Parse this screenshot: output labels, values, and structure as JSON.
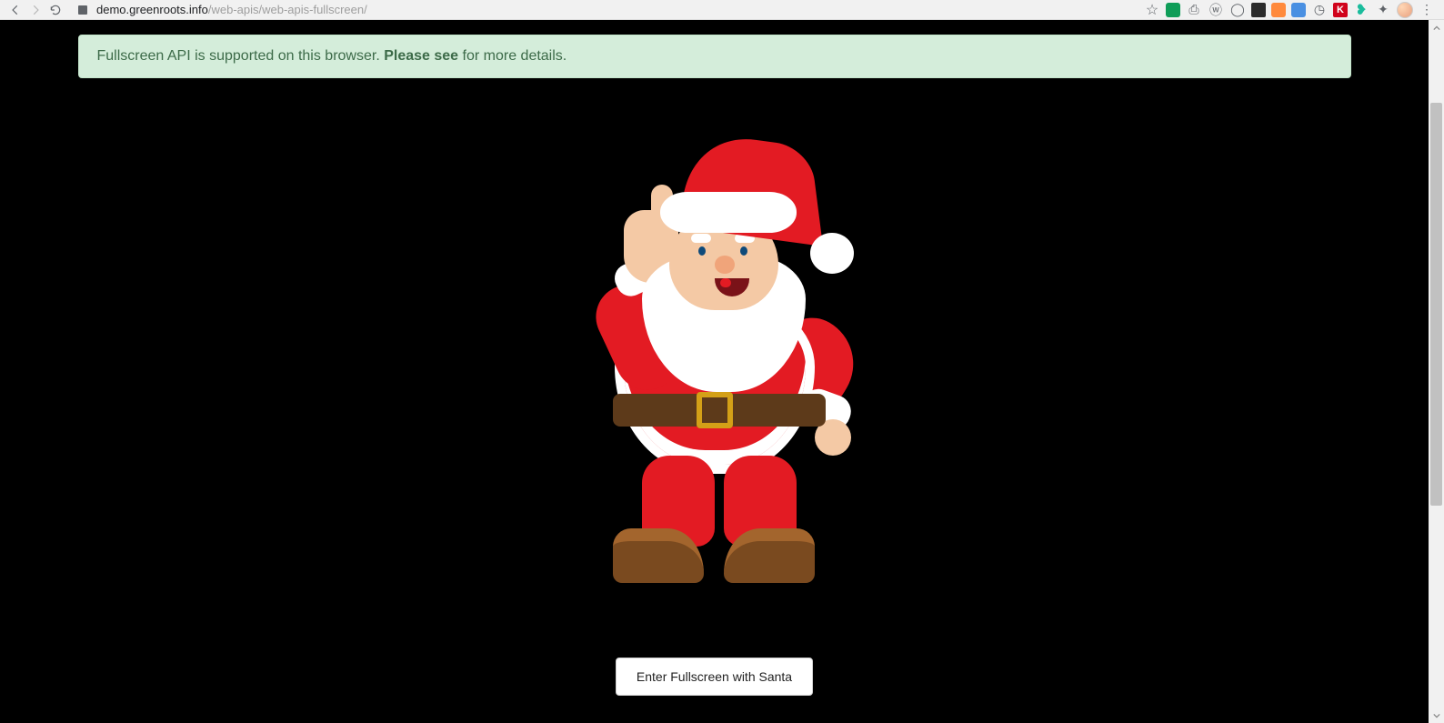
{
  "browser": {
    "url_domain": "demo.greenroots.info",
    "url_path": "/web-apis/web-apis-fullscreen/",
    "nav": {
      "back": "←",
      "forward": "→",
      "reload": "↻"
    },
    "star": "☆",
    "extensions": [
      {
        "name": "evernote-extension-icon",
        "glyph": "",
        "cls": "ext-green square"
      },
      {
        "name": "screenshot-extension-icon",
        "glyph": "⎙",
        "cls": "ext-plain"
      },
      {
        "name": "wordpress-extension-icon",
        "glyph": "ⓦ",
        "cls": "ext-plain"
      },
      {
        "name": "circle-extension-icon",
        "glyph": "◯",
        "cls": "ext-plain"
      },
      {
        "name": "grid-extension-icon",
        "glyph": "",
        "cls": "ext-dark square"
      },
      {
        "name": "swirl-extension-icon",
        "glyph": "",
        "cls": "ext-orange square"
      },
      {
        "name": "search-extension-icon",
        "glyph": "",
        "cls": "ext-blue square"
      },
      {
        "name": "clock-extension-icon",
        "glyph": "◷",
        "cls": "ext-plain"
      },
      {
        "name": "k-extension-icon",
        "glyph": "K",
        "cls": "ext-kred square"
      },
      {
        "name": "tag-extension-icon",
        "glyph": "❥",
        "cls": "ext-teal"
      },
      {
        "name": "puzzle-extension-icon",
        "glyph": "✦",
        "cls": "ext-plain"
      }
    ],
    "menu_glyph": "⋮"
  },
  "banner": {
    "text_before": "Fullscreen API is supported on this browser. ",
    "link_text": "Please see",
    "text_after": " for more details."
  },
  "main": {
    "image_alt": "santa-claus-image",
    "button_label": "Enter Fullscreen with Santa"
  },
  "colors": {
    "banner_bg": "#d4edda",
    "banner_fg": "#3d6b49",
    "page_bg": "#000000",
    "accent_red": "#e31b23"
  }
}
